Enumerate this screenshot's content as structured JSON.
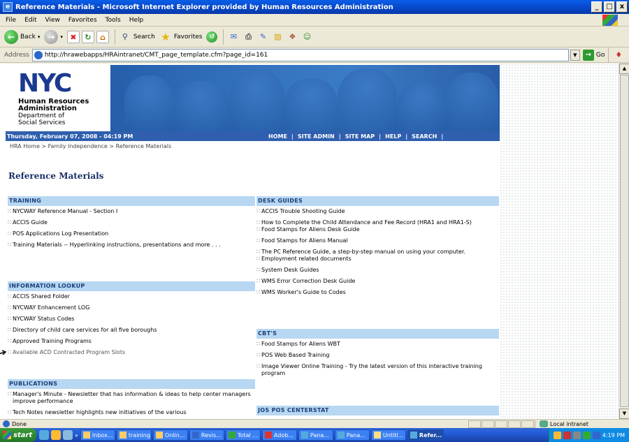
{
  "window": {
    "title": "Reference Materials - Microsoft Internet Explorer provided by Human Resources Administration",
    "buttons": [
      "_",
      "□",
      "x"
    ]
  },
  "menu": [
    "File",
    "Edit",
    "View",
    "Favorites",
    "Tools",
    "Help"
  ],
  "toolbar": {
    "back": "Back",
    "search": "Search",
    "favorites": "Favorites"
  },
  "address": {
    "label": "Address",
    "url": "http://hrawebapps/HRAintranet/CMT_page_template.cfm?page_id=161",
    "go": "Go"
  },
  "banner": {
    "logo": "NYC",
    "org_line1": "Human Resources",
    "org_line2": "Administration",
    "org_line3": "Department of",
    "org_line4": "Social Services"
  },
  "nav": {
    "date": "Thursday, February 07, 2008 - 04:19 PM",
    "links": [
      "HOME",
      "SITE ADMIN",
      "SITE MAP",
      "HELP",
      "SEARCH"
    ]
  },
  "breadcrumb": "HRA Home > Family Independence > Reference Materials",
  "page_title": "Reference Materials",
  "sections_left": [
    {
      "title": "TRAINING",
      "items": [
        "NYCWAY Reference Manual - Section I",
        "ACCIS Guide",
        "POS Applications Log Presentation",
        "Training Materials -- Hyperlinking instructions, presentations and more . . ."
      ]
    },
    {
      "title": "INFORMATION LOOKUP",
      "items": [
        "ACCIS Shared Folder",
        "NYCWAY Enhancement LOG",
        "NYCWAY Status Codes",
        "Directory of child care services for all five boroughs",
        "Approved Training Programs",
        "Available ACD Contracted Program Slots"
      ]
    },
    {
      "title": "PUBLICATIONS",
      "items": [
        "Manager's Minute - Newsletter that has information & ideas to help center managers improve performance",
        "Tech Notes newsletter highlights new initiatives of the various"
      ]
    }
  ],
  "sections_right": [
    {
      "title": "DESK GUIDES",
      "items": [
        "ACCIS Trouble Shooting Guide",
        "How to Complete the Child Attendance and Fee Record (HRA1 and HRA1-S)",
        "Food Stamps for Aliens Desk Guide",
        "Food Stamps for Aliens Manual",
        "The PC Reference Guide, a step-by-step manual on using your computer.",
        "Employment related documents",
        "System Desk Guides",
        "WMS Error Correction Desk Guide",
        "WMS Worker's Guide to Codes"
      ]
    },
    {
      "title": "CBT'S",
      "items": [
        "Food Stamps for Aliens WBT",
        "POS Web Based Training",
        "Image Viewer Online Training - Try the latest version of this interactive training program"
      ]
    },
    {
      "title": "JOS POS CENTERSTAT",
      "items": []
    }
  ],
  "status": {
    "text": "Done",
    "zone": "Local intranet"
  },
  "taskbar": {
    "start": "start",
    "tasks": [
      "Inbox...",
      "training",
      "Onlin...",
      "Revis...",
      "Total ...",
      "Adob...",
      "Pana...",
      "Pana...",
      "Untitl...",
      "Refer..."
    ],
    "active_index": 9,
    "clock": "4:19 PM"
  }
}
